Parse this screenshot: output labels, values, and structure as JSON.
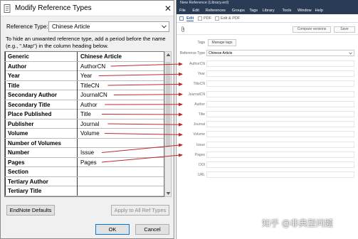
{
  "dialog": {
    "title": "Modify Reference Types",
    "close_glyph": "✕",
    "reference_type_label": "Reference Type:",
    "reference_type_value": "Chinese Article",
    "instructions": "To hide an unwanted reference type, add a period before the name (e.g., \".Map\") in the column heading below.",
    "table": {
      "header_left": "Generic",
      "header_right": "Chinese Article",
      "rows": [
        {
          "generic": "Author",
          "value": "AuthorCN"
        },
        {
          "generic": "Year",
          "value": "Year"
        },
        {
          "generic": "Title",
          "value": "TitleCN"
        },
        {
          "generic": "Secondary Author",
          "value": "JournalCN"
        },
        {
          "generic": "Secondary Title",
          "value": "Author"
        },
        {
          "generic": "Place Published",
          "value": "Title"
        },
        {
          "generic": "Publisher",
          "value": "Journal"
        },
        {
          "generic": "Volume",
          "value": "Volume"
        },
        {
          "generic": "Number of Volumes",
          "value": ""
        },
        {
          "generic": "Number",
          "value": "Issue"
        },
        {
          "generic": "Pages",
          "value": "Pages"
        },
        {
          "generic": "Section",
          "value": ""
        },
        {
          "generic": "Tertiary Author",
          "value": ""
        },
        {
          "generic": "Tertiary Title",
          "value": ""
        }
      ]
    },
    "buttons": {
      "defaults": "EndNote Defaults",
      "apply_all": "Apply to All Ref Types",
      "ok": "OK",
      "cancel": "Cancel"
    }
  },
  "app": {
    "title": "New Reference (Library.enl)",
    "menu": [
      "File",
      "Edit",
      "References",
      "Groups",
      "Tags",
      "Library",
      "Tools",
      "Window",
      "Help"
    ],
    "tabs": [
      "Edit",
      "PDF",
      "Edit & PDF"
    ],
    "buttons": {
      "compare_versions": "Compare versions",
      "save": "Save",
      "manage_tags": "Manage tags"
    },
    "tags_label": "Tags",
    "reference_type_label": "Reference Type",
    "reference_type_value": "Chinese Article",
    "fields": [
      "AuthorCN",
      "Year",
      "TitleCN",
      "JournalCN",
      "Author",
      "Title",
      "Journal",
      "Volume",
      "Issue",
      "Pages",
      "DOI",
      "URL"
    ]
  },
  "colors": {
    "arrow": "#c0282d",
    "app_title_bar": "#2a3b55",
    "link_blue": "#2b5fa8"
  },
  "icons": {
    "dialog_icon": "document-icon",
    "attach": "paperclip-icon",
    "chevron": "chevron-down-icon"
  },
  "watermark": "知乎 @非典型问题"
}
